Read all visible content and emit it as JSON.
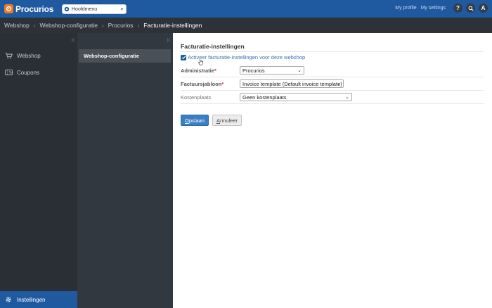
{
  "topbar": {
    "logo_text": "Procurios",
    "menu_label": "Hoofdmenu",
    "my_profile": "My profile",
    "my_settings": "My settings",
    "help_label": "?",
    "avatar_initial": "A"
  },
  "breadcrumb": [
    "Webshop",
    "Webshop-configuratie",
    "Procurios",
    "Facturatie-instellingen"
  ],
  "sidebar": {
    "items": [
      {
        "label": "Webshop",
        "icon": "cart-icon"
      },
      {
        "label": "Coupons",
        "icon": "coupon-icon"
      }
    ],
    "bottom_label": "Instellingen"
  },
  "midcol": {
    "active_item": "Webshop-configuratie"
  },
  "content": {
    "title": "Facturatie-instellingen",
    "checkbox_label": "Activeer facturatie-instellingen voor deze webshop",
    "fields": [
      {
        "label": "Administratie",
        "required": "*",
        "value": "Procurios"
      },
      {
        "label": "Factuursjabloon",
        "required": "*",
        "value": "Invoice template (Default invoice template)"
      },
      {
        "label": "Kostenplaats",
        "required": "",
        "value": "Geen kostenplaats"
      }
    ],
    "save_label_first": "O",
    "save_label_rest": "pslaan",
    "cancel_label_first": "A",
    "cancel_label_rest": "nnuleer"
  },
  "colors": {
    "topbar": "#1f5aa0",
    "sidebar": "#2a2f35",
    "accent": "#3a7fc4",
    "required": "#d0322d"
  }
}
